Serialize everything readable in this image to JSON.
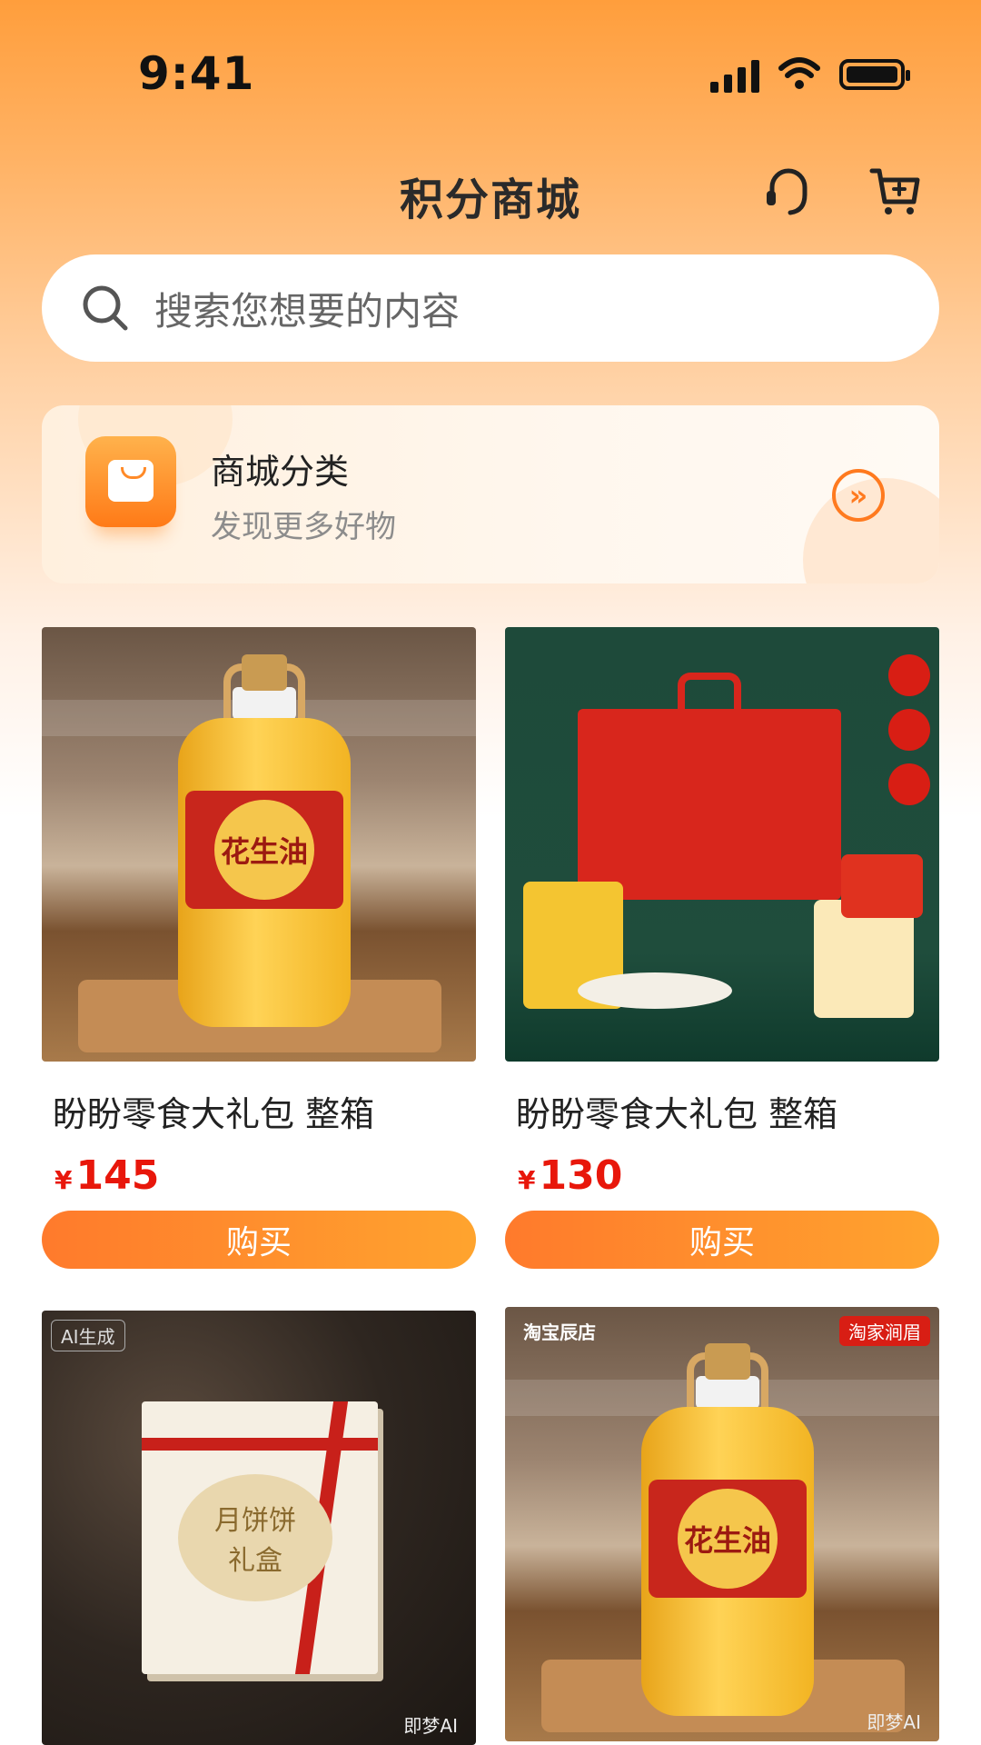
{
  "status_bar": {
    "time": "9:41"
  },
  "header": {
    "title": "积分商城"
  },
  "search": {
    "placeholder": "搜索您想要的内容"
  },
  "category_card": {
    "title": "商城分类",
    "subtitle": "发现更多好物"
  },
  "products": [
    {
      "name": "盼盼零食大礼包 整箱",
      "currency": "¥",
      "price": "145",
      "buy_label": "购买",
      "image_label": "花生油"
    },
    {
      "name": "盼盼零食大礼包 整箱",
      "currency": "¥",
      "price": "130",
      "buy_label": "购买",
      "image_label": ""
    },
    {
      "image_label_line1": "月饼饼",
      "image_label_line2": "礼盒",
      "corner_tag": "AI生成",
      "watermark": "即梦AI"
    },
    {
      "image_label": "花生油",
      "corner_tag_left": "淘宝辰店",
      "corner_tag_right": "淘家涧眉",
      "watermark": "即梦AI"
    }
  ],
  "colors": {
    "accent": "#FF7A2C",
    "price": "#E8170B",
    "header_bg": "#FF9E3C"
  }
}
